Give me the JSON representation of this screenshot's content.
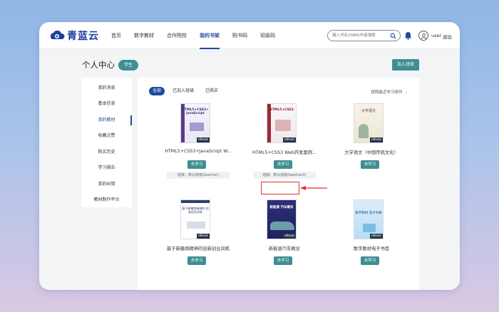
{
  "header": {
    "logo_text": "青蓝云",
    "nav": [
      "首页",
      "数字教材",
      "合作院校",
      "我的书架",
      "购书码",
      "班级码"
    ],
    "active_nav": 3,
    "search_placeholder": "输入书名/ISBN/作者搜索",
    "user_name": "user",
    "logout_label": "退出"
  },
  "page": {
    "title": "个人中心",
    "role_badge": "学生",
    "join_class_button": "加入班级"
  },
  "sidebar": {
    "items": [
      "我的消息",
      "基本信息",
      "我的教材",
      "收藏点赞",
      "购买历史",
      "学习报告",
      "我的纠错",
      "教材制作平台"
    ],
    "active_index": 2
  },
  "content": {
    "tabs": [
      "全部",
      "已加入班级",
      "已购买"
    ],
    "active_tab": 0,
    "sort_label": "按照最近学习排列",
    "ebook_tag": "eBook",
    "books": [
      {
        "title": "HTML5+CSS3+JavaScript W...",
        "button": "去学习",
        "class_tag": "班级：默认班级(teacher)",
        "cover_title": "HTML5+CSS3+ JavaScript"
      },
      {
        "title": "HTML5+CSS3 Web开发案例...",
        "button": "去学习",
        "class_tag": "班级：默认班级(teacher2)",
        "cover_title": "HTML5+CSS3"
      },
      {
        "title": "大学语文（中国传统文化）",
        "button": "去学习",
        "cover_title": "大学语文"
      },
      {
        "title": "基于新徽商精神的创新创业训练",
        "button": "去学习",
        "cover_title": "基于新徽商精神的 创新创业训练"
      },
      {
        "title": "新能源汽车概论",
        "button": "去学习",
        "cover_title": "新能源 汽车概论"
      },
      {
        "title": "数字教材电子书目",
        "button": "去学习",
        "cover_title": "数字教材 电子书目"
      }
    ]
  },
  "colors": {
    "primary": "#1f4a9c",
    "teal": "#3e8e93",
    "highlight": "#e03131"
  }
}
